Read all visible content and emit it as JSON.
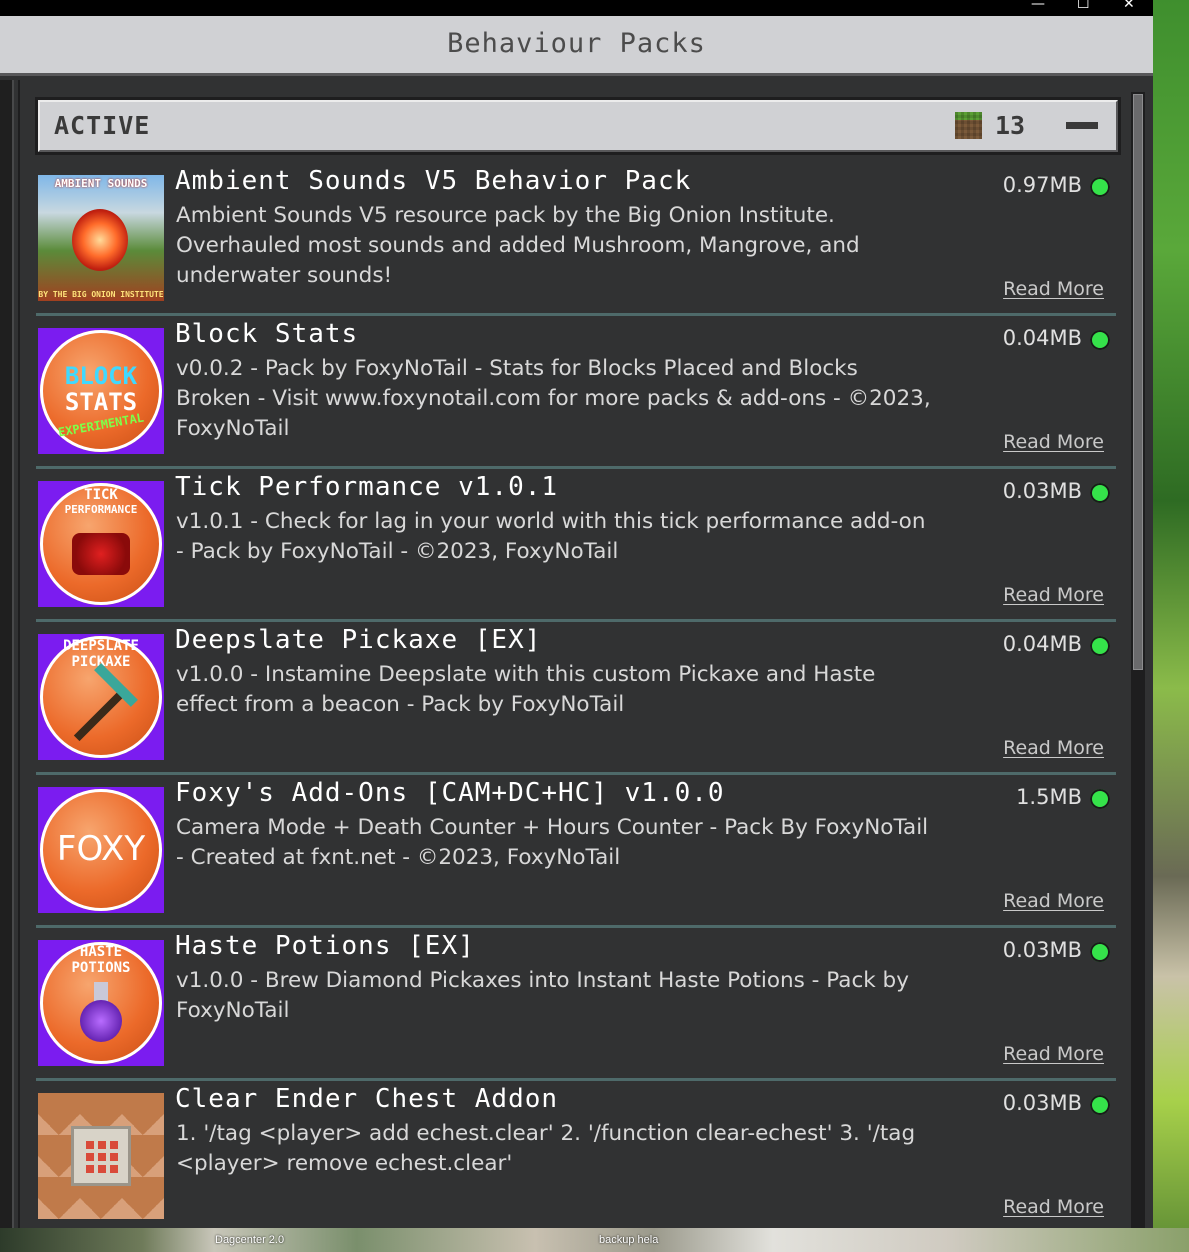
{
  "window": {
    "controls": {
      "minimize": "—",
      "maximize": "☐",
      "close": "✕"
    }
  },
  "header": {
    "title": "Behaviour Packs"
  },
  "active_section": {
    "label": "ACTIVE",
    "count": "13",
    "collapse_icon": "minus-icon"
  },
  "packs": [
    {
      "name": "Ambient Sounds V5 Behavior Pack",
      "description": "Ambient Sounds V5 resource pack by the Big Onion Institute. Overhauled most sounds and added Mushroom, Mangrove, and underwater sounds!",
      "size": "0.97MB",
      "read_more": "Read More",
      "icon": "ambient-sounds-pack-icon",
      "icon_text_top": "AMBIENT SOUNDS",
      "icon_text_bottom": "BY THE BIG ONION INSTITUTE"
    },
    {
      "name": "Block Stats",
      "description": "v0.0.2 - Pack by FoxyNoTail - Stats for Blocks Placed and Blocks Broken - Visit www.foxynotail.com for more packs & add-ons - ©2023, FoxyNoTail",
      "size": "0.04MB",
      "read_more": "Read More",
      "icon": "block-stats-pack-icon",
      "icon_text_top": "BLOCK",
      "icon_text_mid": "STATS",
      "icon_text_bottom": "EXPERIMENTAL"
    },
    {
      "name": "Tick Performance v1.0.1",
      "description": "v1.0.1 - Check for lag in your world with this tick performance add-on - Pack by FoxyNoTail - ©2023, FoxyNoTail",
      "size": "0.03MB",
      "read_more": "Read More",
      "icon": "tick-performance-pack-icon",
      "icon_text_top": "TICK",
      "icon_text_mid": "PERFORMANCE"
    },
    {
      "name": "Deepslate Pickaxe [EX]",
      "description": "v1.0.0 - Instamine Deepslate with this custom Pickaxe and Haste effect from a beacon - Pack by FoxyNoTail",
      "size": "0.04MB",
      "read_more": "Read More",
      "icon": "deepslate-pickaxe-pack-icon",
      "icon_text_top": "DEEPSLATE",
      "icon_text_mid": "PICKAXE"
    },
    {
      "name": "Foxy's Add-Ons [CAM+DC+HC] v1.0.0",
      "description": "Camera Mode + Death Counter + Hours Counter - Pack By FoxyNoTail - Created at fxnt.net - ©2023, FoxyNoTail",
      "size": "1.5MB",
      "read_more": "Read More",
      "icon": "foxy-addons-pack-icon",
      "icon_text_mid": "FOXY"
    },
    {
      "name": "Haste Potions [EX]",
      "description": "v1.0.0 - Brew Diamond Pickaxes into Instant Haste Potions - Pack by FoxyNoTail",
      "size": "0.03MB",
      "read_more": "Read More",
      "icon": "haste-potions-pack-icon",
      "icon_text_top": "HASTE",
      "icon_text_mid": "POTIONS"
    },
    {
      "name": "Clear Ender Chest Addon",
      "description": "1. '/tag <player> add echest.clear' 2. '/function clear-echest' 3. '/tag <player> remove echest.clear'",
      "size": "0.03MB",
      "read_more": "Read More",
      "icon": "command-block-pack-icon"
    }
  ],
  "taskbar": {
    "item1": "Dagcenter 2.0",
    "item2": "backup hela"
  },
  "colors": {
    "status_active": "#35e34a",
    "panel_bg": "#313233",
    "header_bg": "#d0d1d4",
    "separator": "#4e6a6a"
  }
}
